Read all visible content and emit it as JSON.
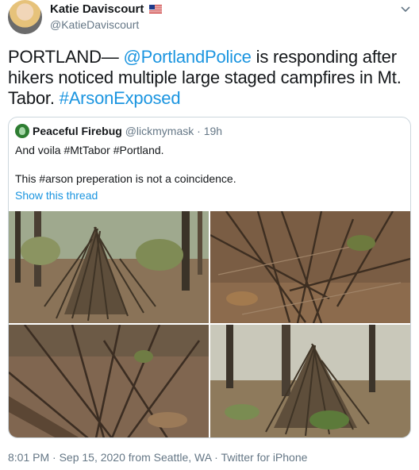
{
  "author": {
    "name": "Katie Daviscourt",
    "handle": "@KatieDaviscourt"
  },
  "tweet": {
    "t1": "PORTLAND— ",
    "mention": "@PortlandPolice",
    "t2": " is responding after hikers noticed multiple large staged campfires in Mt. Tabor.  ",
    "hashtag": "#ArsonExposed"
  },
  "quote": {
    "name": "Peaceful Firebug",
    "handle": "@lickmymask",
    "time": " · 19h",
    "line1": "And voila #MtTabor #Portland.",
    "line2": "This #arson preperation is not a coincidence.",
    "show_thread": "Show this thread"
  },
  "photos": [
    {
      "label": "forest-campfire-photo-1"
    },
    {
      "label": "forest-campfire-photo-2"
    },
    {
      "label": "forest-campfire-photo-3"
    },
    {
      "label": "forest-campfire-photo-4"
    }
  ],
  "footer": "8:01 PM · Sep 15, 2020 from Seattle, WA · Twitter for iPhone",
  "colors": {
    "link": "#1b95e0",
    "muted": "#657786",
    "border": "#ccd6dd"
  }
}
